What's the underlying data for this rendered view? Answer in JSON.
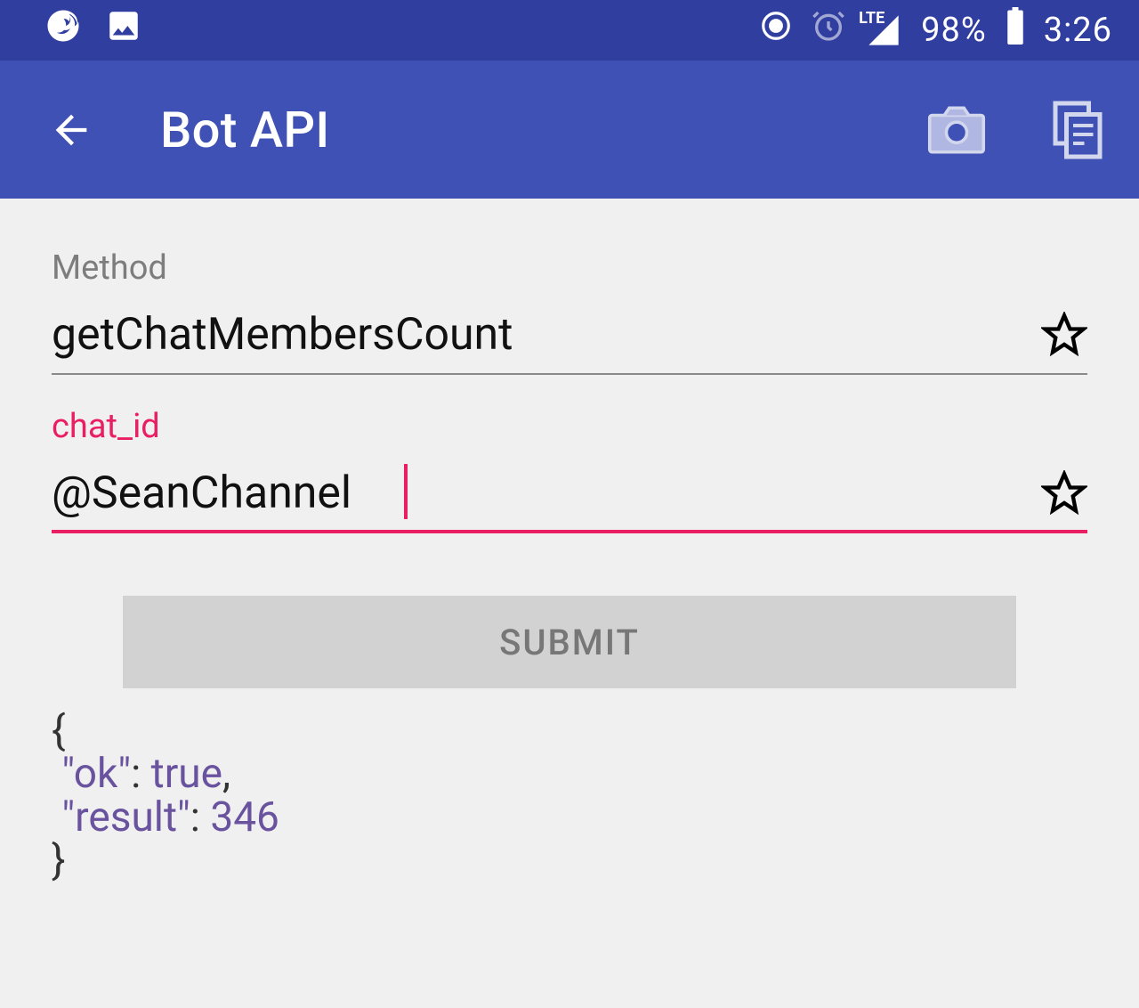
{
  "statusbar": {
    "lte_label": "LTE",
    "battery_pct": "98%",
    "clock": "3:26"
  },
  "appbar": {
    "title": "Bot API"
  },
  "form": {
    "method_label": "Method",
    "method_value": "getChatMembersCount",
    "chatid_label": "chat_id",
    "chatid_value": "@SeanChannel",
    "submit_label": "SUBMIT"
  },
  "result": {
    "open": "{",
    "ok_key": "\"ok\"",
    "ok_val": "true",
    "result_key": "\"result\"",
    "result_val": "346",
    "close": "}"
  }
}
